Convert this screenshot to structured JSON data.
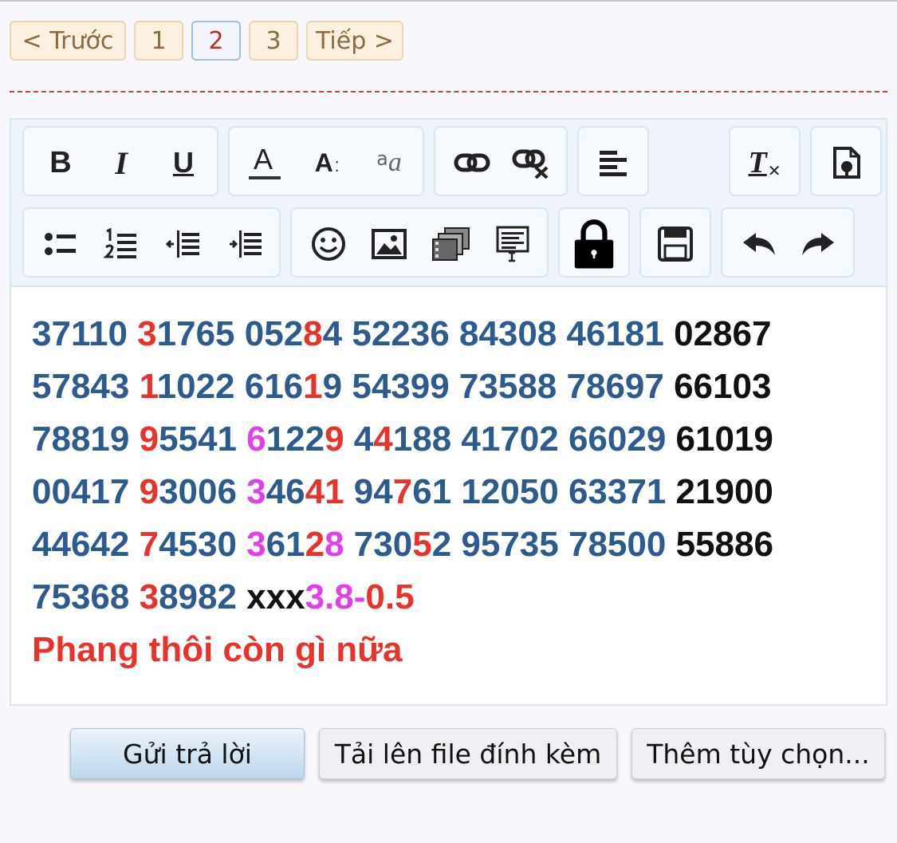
{
  "pagination": {
    "prev": "< Trước",
    "pages": [
      "1",
      "2",
      "3"
    ],
    "current": "2",
    "next": "Tiếp >"
  },
  "toolbar": {
    "row1": [
      "bold-icon",
      "italic-icon",
      "underline-icon",
      "text-color-icon",
      "font-size-icon",
      "font-family-icon",
      "link-icon",
      "unlink-icon",
      "align-icon",
      "remove-format-icon",
      "smilie-plus-icon"
    ],
    "row2": [
      "bullet-list-icon",
      "numbered-list-icon",
      "outdent-icon",
      "indent-icon",
      "smiley-icon",
      "image-icon",
      "media-icon",
      "code-icon",
      "lock-icon",
      "save-icon",
      "undo-icon",
      "redo-icon"
    ],
    "bold_label": "B",
    "italic_label": "I",
    "underline_label": "U",
    "text_color_label": "A",
    "font_size_label": "A",
    "font_family_label": "a",
    "remove_format_label": "T"
  },
  "content": {
    "lines": [
      [
        [
          "37110 ",
          "b"
        ],
        [
          "3",
          "r"
        ],
        [
          "1765 ",
          "b"
        ],
        [
          "052",
          "b"
        ],
        [
          "8",
          "r"
        ],
        [
          "4 ",
          "b"
        ],
        [
          "52236 84308 46181 ",
          "b"
        ],
        [
          "02867",
          "k"
        ]
      ],
      [
        [
          "57843 ",
          "b"
        ],
        [
          "1",
          "r"
        ],
        [
          "1022 ",
          "b"
        ],
        [
          "616",
          "b"
        ],
        [
          "1",
          "r"
        ],
        [
          "9 ",
          "b"
        ],
        [
          "54399 73588 78697 ",
          "b"
        ],
        [
          "66103",
          "k"
        ]
      ],
      [
        [
          "78819 ",
          "b"
        ],
        [
          "9",
          "r"
        ],
        [
          "5541 ",
          "b"
        ],
        [
          "6",
          "m"
        ],
        [
          "122",
          "b"
        ],
        [
          "9",
          "r"
        ],
        [
          " 4",
          "b"
        ],
        [
          "4",
          "r"
        ],
        [
          "188 41702 66029 ",
          "b"
        ],
        [
          "61019",
          "k"
        ]
      ],
      [
        [
          "00417 ",
          "b"
        ],
        [
          "9",
          "r"
        ],
        [
          "3006 ",
          "b"
        ],
        [
          "3",
          "m"
        ],
        [
          "46",
          "b"
        ],
        [
          "41",
          "r"
        ],
        [
          " 94",
          "b"
        ],
        [
          "7",
          "r"
        ],
        [
          "61 12050 63371 ",
          "b"
        ],
        [
          "21900",
          "k"
        ]
      ],
      [
        [
          "44642 ",
          "b"
        ],
        [
          "7",
          "r"
        ],
        [
          "4530 ",
          "b"
        ],
        [
          "3",
          "m"
        ],
        [
          "61",
          "b"
        ],
        [
          "2",
          "r"
        ],
        [
          "8",
          "m"
        ],
        [
          " 730",
          "b"
        ],
        [
          "5",
          "r"
        ],
        [
          "2 95735 78500 ",
          "b"
        ],
        [
          "55886",
          "k"
        ]
      ],
      [
        [
          "75368 ",
          "b"
        ],
        [
          "3",
          "r"
        ],
        [
          "8982 ",
          "b"
        ],
        [
          "xxx",
          "k"
        ],
        [
          "3.8-",
          "m"
        ],
        [
          "0.5",
          "r"
        ]
      ]
    ],
    "signature": "Phang thôi còn gì nữa"
  },
  "actions": {
    "reply": "Gửi trả lời",
    "upload": "Tải lên file đính kèm",
    "more": "Thêm tùy chọn..."
  },
  "colors": {
    "number_blue": "#2e5b8e",
    "highlight_red": "#e8332a",
    "highlight_magenta": "#e040e8"
  }
}
